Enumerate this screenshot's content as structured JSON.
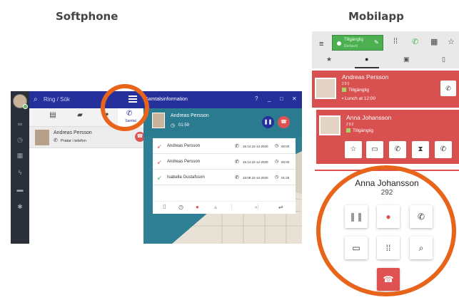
{
  "headings": {
    "softphone": "Softphone",
    "mobilapp": "Mobilapp"
  },
  "colors": {
    "accent_blue": "#25309a",
    "hangup_red": "#e05252",
    "busy_red": "#d85050",
    "available_green": "#4caf50",
    "highlight_orange": "#e8641b"
  },
  "softphone": {
    "search_placeholder": "Ring / Sök",
    "call_tab_label": "Samtal",
    "info_title": "Samtalsinformation",
    "window_controls": [
      "?",
      "_",
      "□",
      "✕"
    ],
    "active_call": {
      "name": "Andreas Persson",
      "status": "Pratar i telefon"
    },
    "call_card": {
      "name": "Andreas Persson",
      "timer": "01:59"
    },
    "history": [
      {
        "name": "Andreas Persson",
        "date": "16:14 22-12-2020",
        "duration": "00:00",
        "direction": "missed"
      },
      {
        "name": "Andreas Persson",
        "date": "16:14 22-12-2020",
        "duration": "00:00",
        "direction": "missed"
      },
      {
        "name": "Isabella Gustafsson",
        "date": "15:09 22-12-2020",
        "duration": "01:25",
        "direction": "incoming"
      }
    ],
    "rail_icons": [
      "voicemail-icon",
      "history-icon",
      "calendar-icon",
      "flash-icon",
      "chat-icon",
      "settings-icon"
    ],
    "tab_icons": [
      "contact-card-icon",
      "chat-icon",
      "group-icon",
      "phone-icon"
    ]
  },
  "mobilapp": {
    "status": {
      "label": "Tillgänglig",
      "sub": "Default"
    },
    "contacts": [
      {
        "name": "Andreas Persson",
        "number": "291",
        "status": "Tillgänglig",
        "calendar": "Lunch at 12:00"
      },
      {
        "name": "Anna Johansson",
        "number": "292",
        "status": "Tillgänglig"
      }
    ],
    "active_call": {
      "name": "Anna Johansson",
      "number": "292"
    }
  }
}
